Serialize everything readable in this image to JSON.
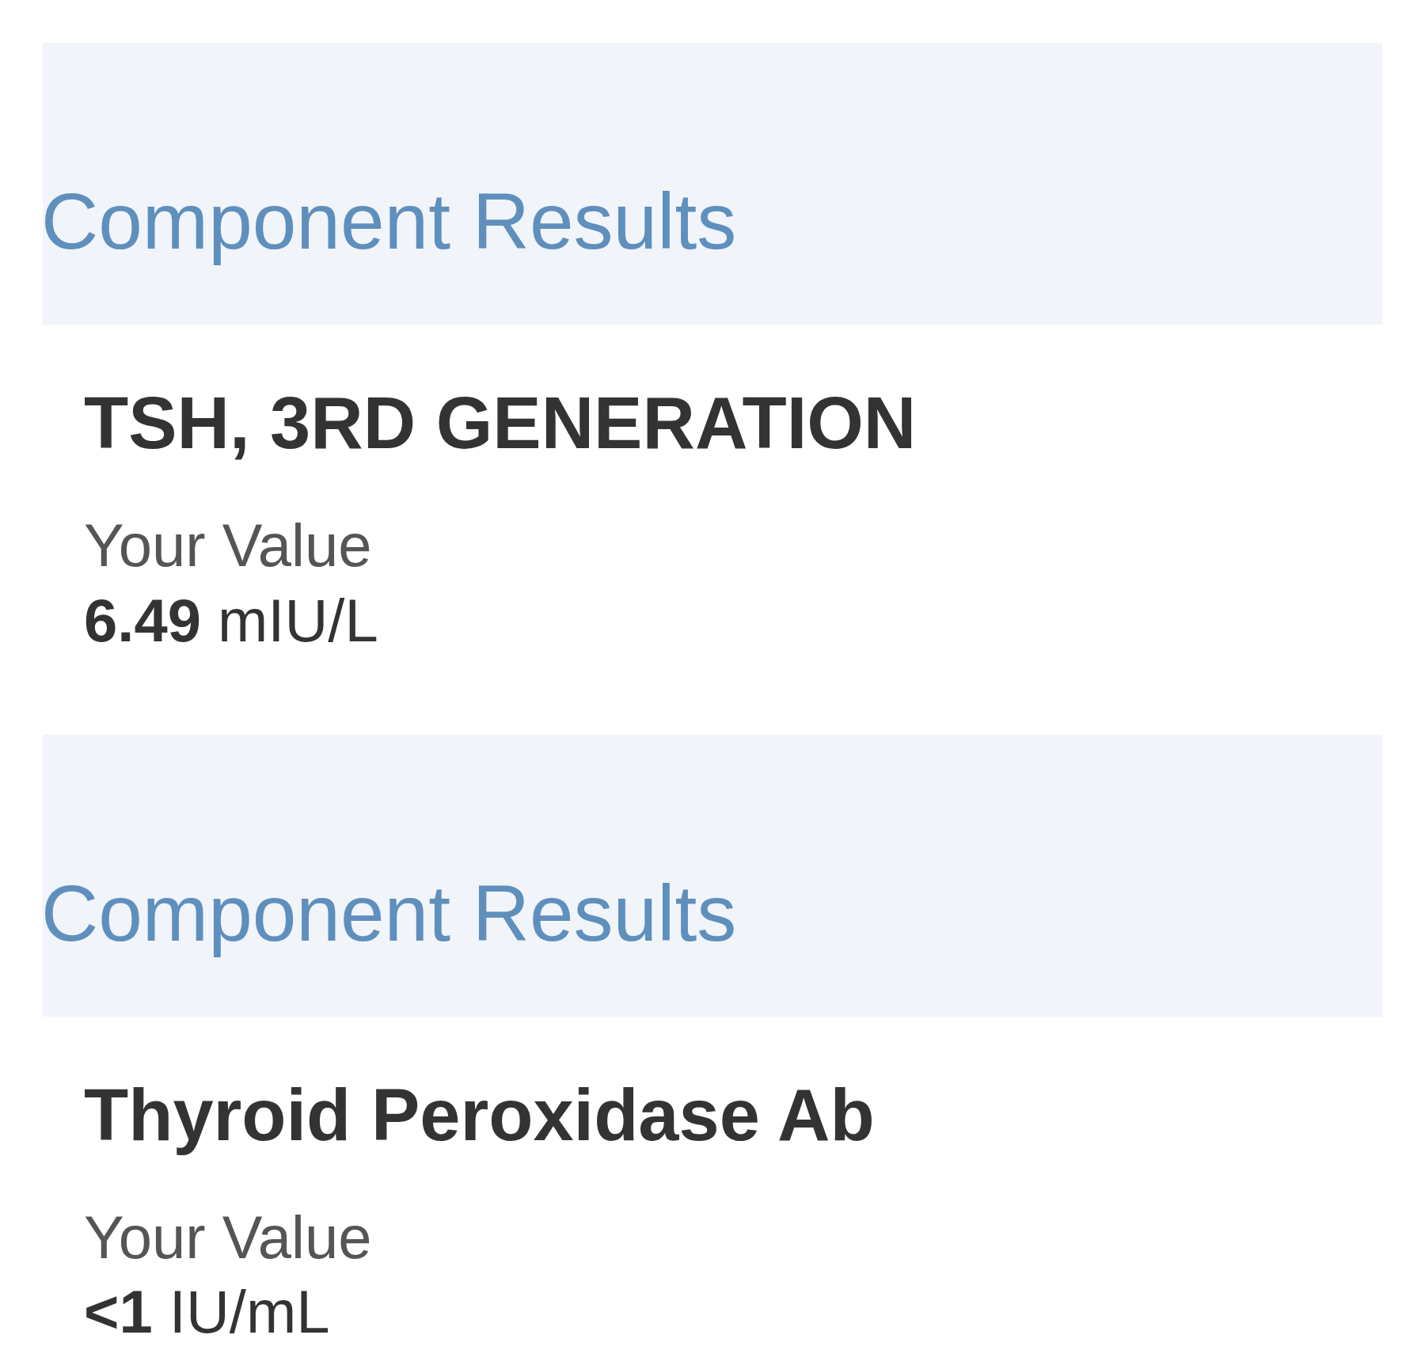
{
  "sections": [
    {
      "heading": "Component Results",
      "result": {
        "name": "TSH, 3RD GENERATION",
        "label": "Your Value",
        "value": "**6.49** mIU/L"
      }
    },
    {
      "heading": "Component Results",
      "result": {
        "name": "Thyroid Peroxidase Ab",
        "label": "Your Value",
        "value": "**<1** IU/mL"
      }
    }
  ]
}
